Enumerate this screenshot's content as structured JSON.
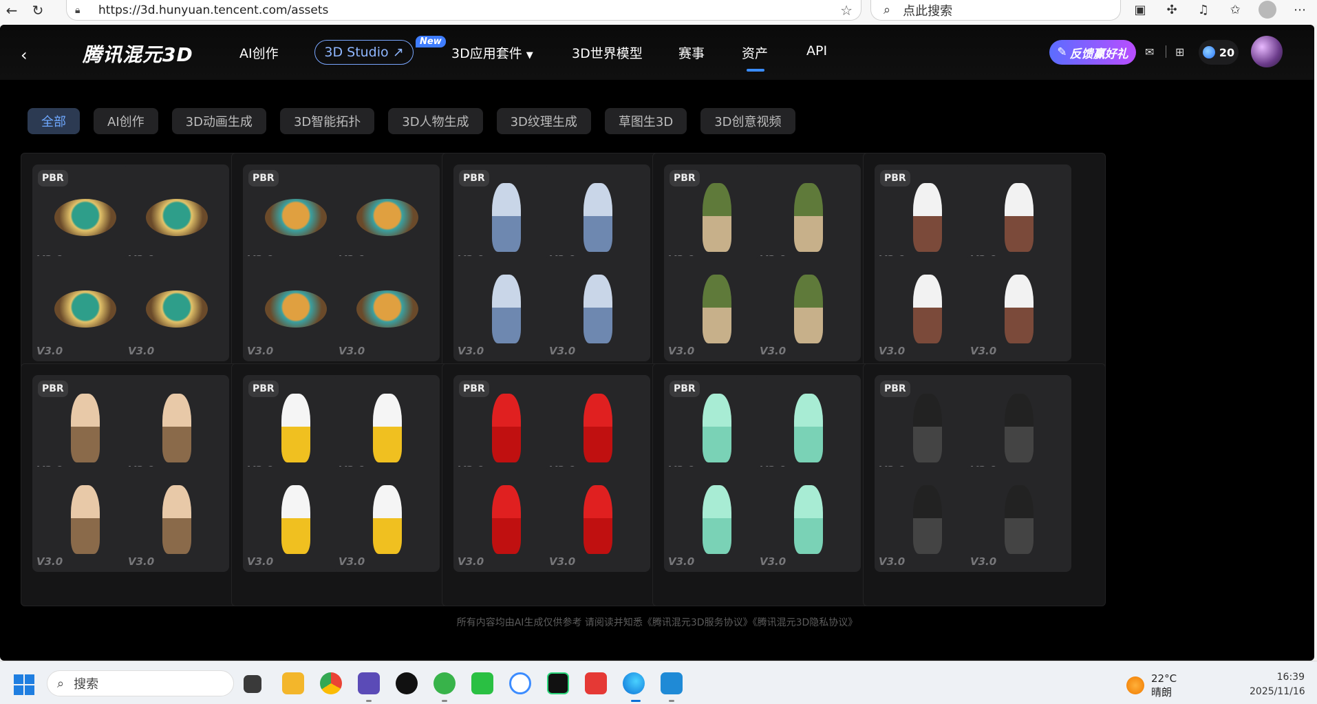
{
  "browser": {
    "url": "https://3d.hunyuan.tencent.com/assets",
    "search_placeholder": "点此搜索"
  },
  "header": {
    "logo": "腾讯混元3D",
    "nav": [
      "AI创作",
      "3D Studio ↗",
      "3D应用套件",
      "3D世界模型",
      "赛事",
      "资产",
      "API"
    ],
    "new_badge": "New",
    "active_nav": "资产",
    "feedback": "反馈赢好礼",
    "credits": "20"
  },
  "filters": {
    "items": [
      "全部",
      "AI创作",
      "3D动画生成",
      "3D智能拓扑",
      "3D人物生成",
      "3D纹理生成",
      "草图生3D",
      "3D创意视频"
    ],
    "active": "全部"
  },
  "labels": {
    "pbr": "PBR",
    "version": "V3.0"
  },
  "disclaimer": "所有内容均由AI生成仅供参考 请阅读并知悉《腾讯混元3D服务协议》《腾讯混元3D隐私协议》",
  "taskbar": {
    "search_placeholder": "搜索",
    "temperature": "22°C",
    "weather": "晴朗",
    "time": "16:39",
    "date": "2025/11/16"
  },
  "colors": {
    "accent": "#3a8cff",
    "filter_active": "#6ea8ff",
    "feedback_start": "#5b6dff",
    "feedback_end": "#b94dff"
  }
}
